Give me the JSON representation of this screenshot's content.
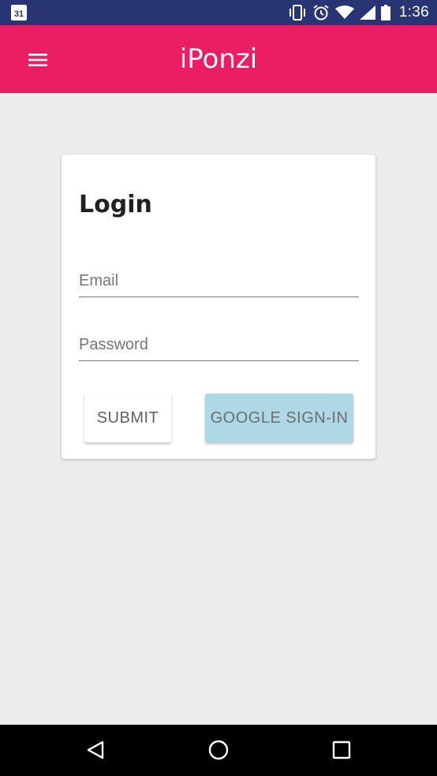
{
  "status_bar": {
    "calendar_day": "31",
    "time": "1:36",
    "icons": [
      "calendar-icon",
      "vibrate-icon",
      "alarm-icon",
      "wifi-icon",
      "signal-icon",
      "battery-icon"
    ]
  },
  "app_bar": {
    "title": "iPonzi",
    "menu_icon": "hamburger-menu-icon",
    "color": "#ec1e63"
  },
  "login_card": {
    "title": "Login",
    "email": {
      "placeholder": "Email",
      "value": ""
    },
    "password": {
      "placeholder": "Password",
      "value": ""
    },
    "submit_label": "SUBMIT",
    "google_label": "GOOGLE SIGN-IN",
    "google_color": "#add8e6"
  },
  "nav_bar": {
    "icons": [
      "back-icon",
      "home-icon",
      "recents-icon"
    ]
  }
}
